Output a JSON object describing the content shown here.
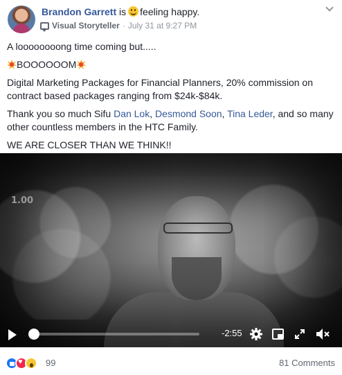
{
  "header": {
    "author": "Brandon Garrett",
    "is_text": "is",
    "feeling": "feeling happy.",
    "badge": "Visual Storyteller",
    "separator": "·",
    "timestamp": "July 31 at 9:27 PM",
    "options_icon": "chevron-down-icon"
  },
  "post": {
    "line1": "A loooooooong time coming but.....",
    "line2": "BOOOOOOM",
    "line3": "Digital Marketing Packages for Financial Planners, 20% commission on contract based packages ranging from $24k-$84k.",
    "line4_start": "Thank you so much Sifu ",
    "link1": "Dan Lok",
    "comma1": ", ",
    "link2": "Desmond Soon",
    "comma2": ", ",
    "link3": "Tina Leder",
    "line4_end": ", and so many other countless members in the HTC Family.",
    "line5": "WE ARE CLOSER THAN WE THINK!!"
  },
  "video": {
    "playback_rate": "1.00",
    "time_remaining": "-2:55",
    "progress": 0.02,
    "icons": [
      "play-icon",
      "gear-icon",
      "picture-in-picture-icon",
      "expand-icon",
      "mute-icon"
    ]
  },
  "footer": {
    "reaction_count": "99",
    "comments": "81 Comments",
    "reactions": [
      "like",
      "love",
      "wow"
    ]
  }
}
